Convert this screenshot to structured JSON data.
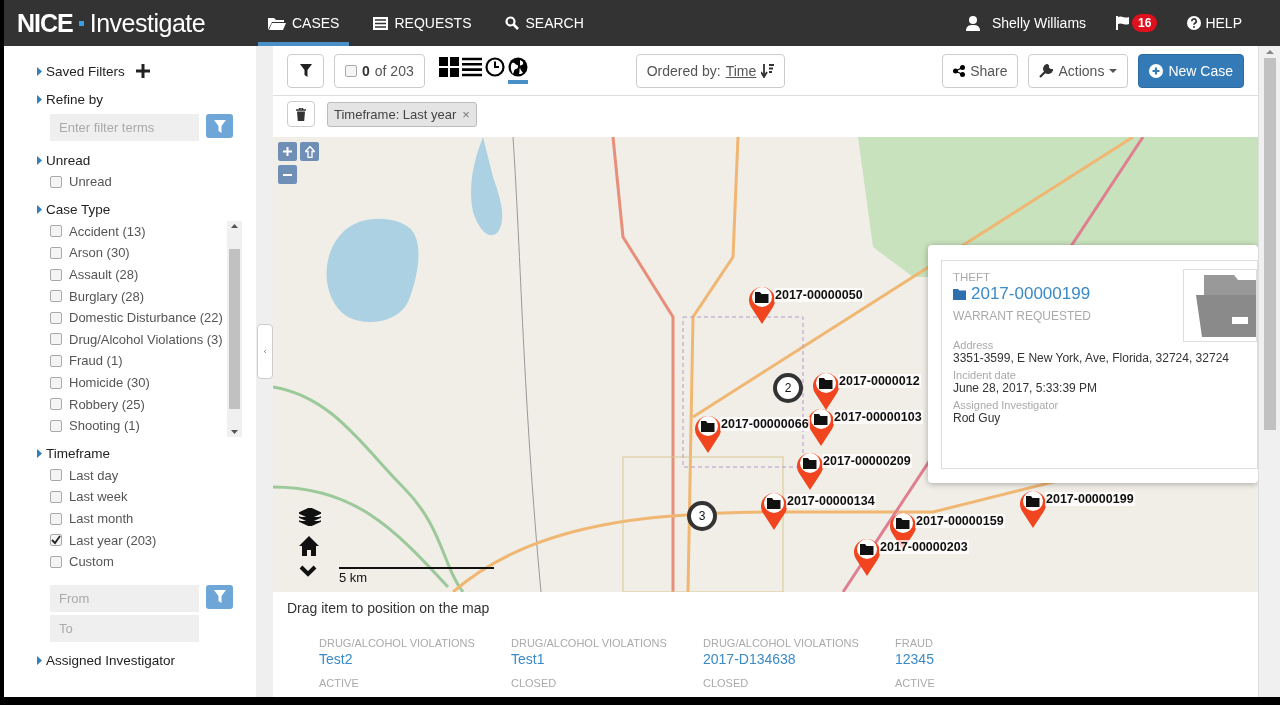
{
  "header": {
    "brand": "NICE",
    "product": "Investigate",
    "nav": [
      {
        "label": "CASES",
        "kind": "folder",
        "selected": true
      },
      {
        "label": "REQUESTS",
        "kind": "list",
        "selected": false
      },
      {
        "label": "SEARCH",
        "kind": "search",
        "selected": false
      }
    ],
    "user": "Shelly Williams",
    "flag_count": "16",
    "help": "HELP"
  },
  "sidebar": {
    "sections": [
      {
        "title": "Saved Filters",
        "kind": "saved"
      },
      {
        "title": "Refine by",
        "kind": "search",
        "placeholder": "Enter filter terms"
      },
      {
        "title": "Unread",
        "kind": "checks",
        "items": [
          {
            "label": "Unread",
            "checked": false
          }
        ]
      },
      {
        "title": "Case Type",
        "kind": "scroll",
        "items": [
          {
            "label": "Accident (13)",
            "checked": false
          },
          {
            "label": "Arson (30)",
            "checked": false
          },
          {
            "label": "Assault (28)",
            "checked": false
          },
          {
            "label": "Burglary (28)",
            "checked": false
          },
          {
            "label": "Domestic Disturbance (22)",
            "checked": false
          },
          {
            "label": "Drug/Alcohol Violations (3)",
            "checked": false
          },
          {
            "label": "Fraud (1)",
            "checked": false
          },
          {
            "label": "Homicide (30)",
            "checked": false
          },
          {
            "label": "Robbery (25)",
            "checked": false
          },
          {
            "label": "Shooting (1)",
            "checked": false
          }
        ]
      },
      {
        "title": "Timeframe",
        "kind": "range",
        "items": [
          {
            "label": "Last day",
            "checked": false
          },
          {
            "label": "Last week",
            "checked": false
          },
          {
            "label": "Last month",
            "checked": false
          },
          {
            "label": "Last year (203)",
            "checked": true
          },
          {
            "label": "Custom",
            "checked": false
          }
        ],
        "from_placeholder": "From",
        "to_placeholder": "To"
      },
      {
        "title": "Assigned Investigator",
        "kind": "heading"
      }
    ]
  },
  "toolbar": {
    "selected_count": "0",
    "total": "of 203",
    "select_all": false,
    "views": [
      {
        "kind": "grid",
        "selected": false
      },
      {
        "kind": "list",
        "selected": false
      },
      {
        "kind": "clock",
        "selected": false
      },
      {
        "kind": "globe",
        "selected": true
      }
    ],
    "order_label": "Ordered by:",
    "order_value": "Time",
    "share": "Share",
    "actions": "Actions",
    "new_case": "New Case"
  },
  "filters": [
    {
      "label": "Timeframe: Last year",
      "remove": "×"
    }
  ],
  "map": {
    "markers": [
      {
        "label": "2017-00000050"
      },
      {
        "label": "2017-0000012"
      },
      {
        "label": "2017-00000103"
      },
      {
        "label": "2017-00000066"
      },
      {
        "label": "2017-00000209"
      },
      {
        "label": "2017-00000134"
      },
      {
        "label": "2017-00000199"
      },
      {
        "label": "2017-00000159"
      },
      {
        "label": "2017-00000203"
      }
    ],
    "clusters": [
      {
        "count": "2"
      },
      {
        "count": "3"
      }
    ],
    "scale": "5 km",
    "popup": {
      "type": "THEFT",
      "number": "2017-00000199",
      "status": "WARRANT REQUESTED",
      "fields": [
        {
          "label": "Address",
          "value": "3351-3599, E New York, Ave, Florida, 32724, 32724"
        },
        {
          "label": "Incident date",
          "value": "June 28, 2017, 5:33:39 PM"
        },
        {
          "label": "Assigned Investigator",
          "value": "Rod Guy"
        }
      ]
    }
  },
  "tray": {
    "hint": "Drag item to position on the map",
    "cards": [
      {
        "type": "DRUG/ALCOHOL VIOLATIONS",
        "number": "Test2",
        "status": "ACTIVE"
      },
      {
        "type": "DRUG/ALCOHOL VIOLATIONS",
        "number": "Test1",
        "status": "CLOSED"
      },
      {
        "type": "DRUG/ALCOHOL VIOLATIONS",
        "number": "2017-D134638",
        "status": "CLOSED"
      },
      {
        "type": "FRAUD",
        "number": "12345",
        "status": "ACTIVE"
      }
    ]
  }
}
